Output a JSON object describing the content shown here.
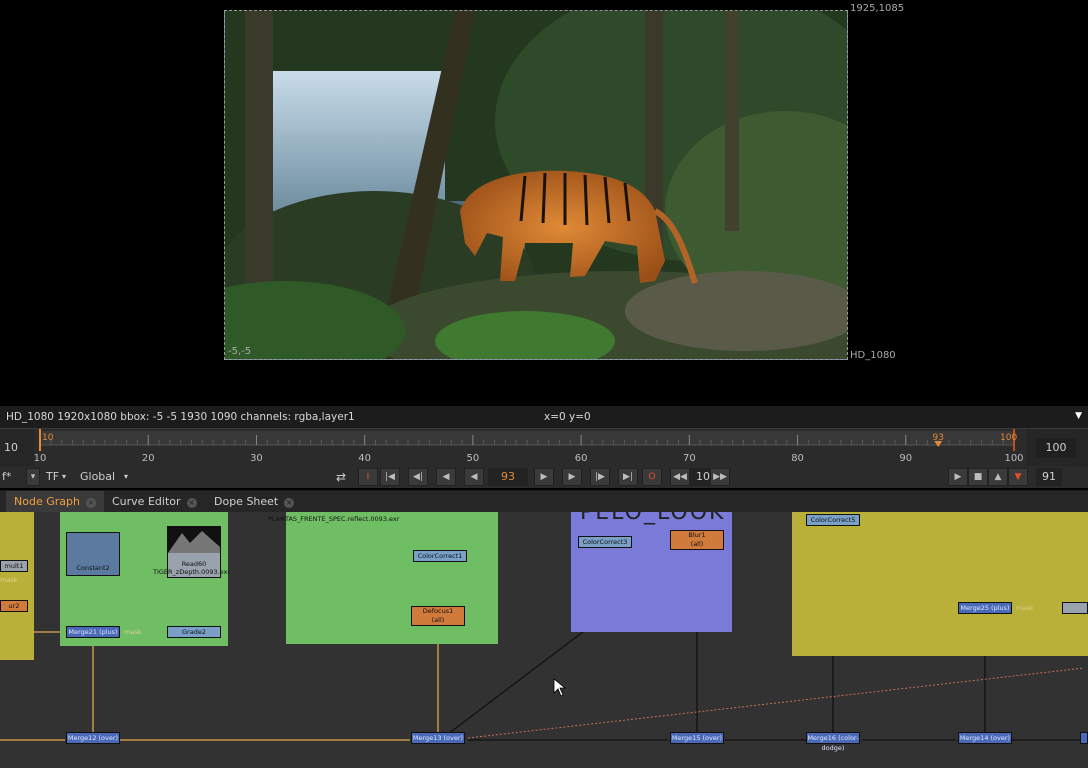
{
  "viewer": {
    "format_label": "HD_1080",
    "top_right_coords": "1925,1085",
    "bottom_left_coords": "-5,-5"
  },
  "infobar": {
    "left": "HD_1080 1920x1080  bbox: -5 -5 1930 1090 channels: rgba,layer1",
    "center": "x=0 y=0"
  },
  "timeline": {
    "in_point": "10",
    "out_point": "100",
    "ticks": [
      "10",
      "20",
      "30",
      "40",
      "50",
      "60",
      "70",
      "80",
      "90",
      "100"
    ],
    "in_marker": "10",
    "current_marker": "93",
    "out_marker": "100",
    "range_start": 10,
    "range_end": 100,
    "current_frame": 93,
    "accent_color": "#e3893b"
  },
  "controls": {
    "fps_label": "f*",
    "tf_label": "TF",
    "global_label": "Global",
    "current_frame": "93",
    "step_value": "10",
    "end_frame": "91"
  },
  "tabs": [
    {
      "label": "Node Graph",
      "active": true
    },
    {
      "label": "Curve Editor",
      "active": false
    },
    {
      "label": "Dope Sheet",
      "active": false
    }
  ],
  "nodes": {
    "mult": "mult1",
    "mask_left": "mask",
    "ur2": "ur2",
    "constant": "Constant2",
    "read60": "Read60",
    "read60_file": "TIGER_zDepth.0093.exr",
    "merge_plus": "Merge21 (plus)",
    "mask_mid": "mask",
    "grade": "Grade2",
    "plants_file": "PLANTAS_FRENTE_SPEC.reflect.0093.exr",
    "cc1": "ColorCorrect1",
    "defocus": "Defocus1",
    "defocus_sub": "(all)",
    "cc3": "ColorCorrect3",
    "blur": "Blur1",
    "blur_sub": "(all)",
    "cc5": "ColorCorrect5",
    "merge_plus2": "Merge25 (plus)",
    "mask_right": "mask",
    "merge12": "Merge12 (over)",
    "merge13": "Merge13 (over)",
    "merge_over_a": "Merge15 (over)",
    "merge16": "Merge16 (color-dodge)",
    "merge14": "Merge14 (over)",
    "purple_title": "PELO_LOOK"
  }
}
